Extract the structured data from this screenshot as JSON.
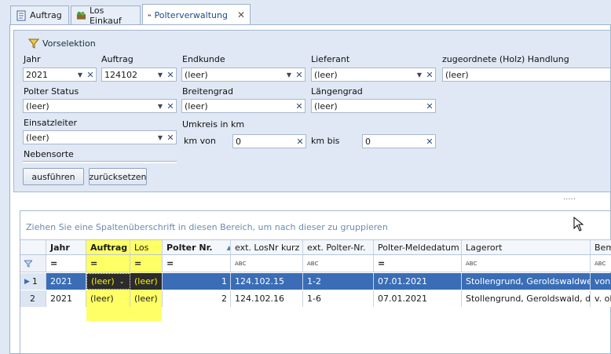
{
  "tabs": [
    {
      "label": "Auftrag",
      "icon": "document-icon"
    },
    {
      "label": "Los Einkauf",
      "icon": "basket-icon"
    },
    {
      "label": "Polterverwaltung",
      "icon": "truck-icon"
    }
  ],
  "vorselektion": {
    "title": "Vorselektion",
    "jahr_label": "Jahr",
    "jahr_value": "2021",
    "auftrag_label": "Auftrag",
    "auftrag_value": "124102",
    "endkunde_label": "Endkunde",
    "endkunde_value": "(leer)",
    "lieferant_label": "Lieferant",
    "lieferant_value": "(leer)",
    "handlung_label": "zugeordnete (Holz) Handlung",
    "handlung_value": "(leer)",
    "polterstatus_label": "Polter Status",
    "polterstatus_value": "(leer)",
    "breitengrad_label": "Breitengrad",
    "breitengrad_value": "(leer)",
    "laengengrad_label": "Längengrad",
    "laengengrad_value": "(leer)",
    "einsatzleiter_label": "Einsatzleiter",
    "einsatzleiter_value": "(leer)",
    "umkreis_label": "Umkreis in km",
    "kmvon_label": "km von",
    "kmvon_value": "0",
    "kmbis_label": "km bis",
    "kmbis_value": "0",
    "nebensorte_label": "Nebensorte",
    "ausfuehren_label": "ausführen",
    "zuruecksetzen_label": "zurücksetzen"
  },
  "grid": {
    "group_hint": "Ziehen Sie eine Spaltenüberschrift in diesen Bereich, um nach dieser zu gruppieren",
    "columns": [
      "Jahr",
      "Auftrag",
      "Los",
      "Polter Nr.",
      "ext. LosNr kurz",
      "ext. Polter-Nr.",
      "Polter-Meldedatum",
      "Lagerort",
      "Bem"
    ],
    "filter_eq": "=",
    "filter_abc": "ABC",
    "rows": [
      {
        "num": "1",
        "jahr": "2021",
        "auftrag": "(leer)",
        "los": "(leer)",
        "polter": "1",
        "extlos": "124.102.15",
        "extpolter": "1-2",
        "datum": "07.01.2021",
        "lagerort": "Stollengrund, Geroldswaldweg...",
        "bem": "von"
      },
      {
        "num": "2",
        "jahr": "2021",
        "auftrag": "(leer)",
        "los": "(leer)",
        "polter": "2",
        "extlos": "124.102.16",
        "extpolter": "1-6",
        "datum": "07.01.2021",
        "lagerort": "Stollengrund, Geroldswald, da...",
        "bem": "v. ol"
      }
    ]
  },
  "colors": {
    "accent": "#3a6db5",
    "highlight": "#ffff66",
    "panel": "#dfe8f4"
  }
}
